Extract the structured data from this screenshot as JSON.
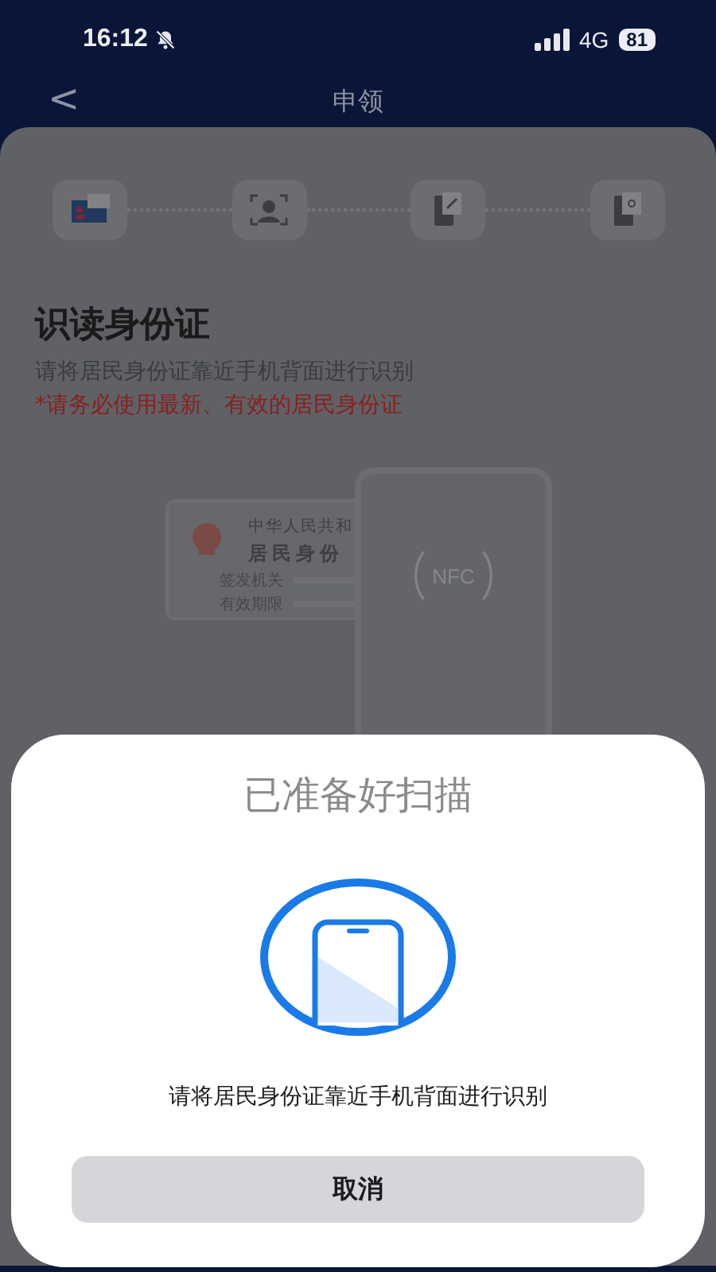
{
  "status_bar": {
    "time": "16:12",
    "silent": true,
    "network": "4G",
    "battery": "81"
  },
  "nav": {
    "back": "<",
    "title": "申领"
  },
  "steps": [
    {
      "kind": "id-card",
      "selected": true
    },
    {
      "kind": "face",
      "selected": false
    },
    {
      "kind": "phone-link",
      "selected": false
    },
    {
      "kind": "phone-key",
      "selected": false
    }
  ],
  "heading": "识读身份证",
  "instruction": "请将居民身份证靠近手机背面进行识别",
  "notice": "*请务必使用最新、有效的居民身份证",
  "illustration": {
    "card_line_1": "中华人民共和",
    "card_line_2": "居民身份",
    "card_fields": [
      "签发机关",
      "有效期限"
    ],
    "nfc": "NFC"
  },
  "sheet": {
    "title": "已准备好扫描",
    "message": "请将居民身份证靠近手机背面进行识别",
    "cancel": "取消"
  }
}
